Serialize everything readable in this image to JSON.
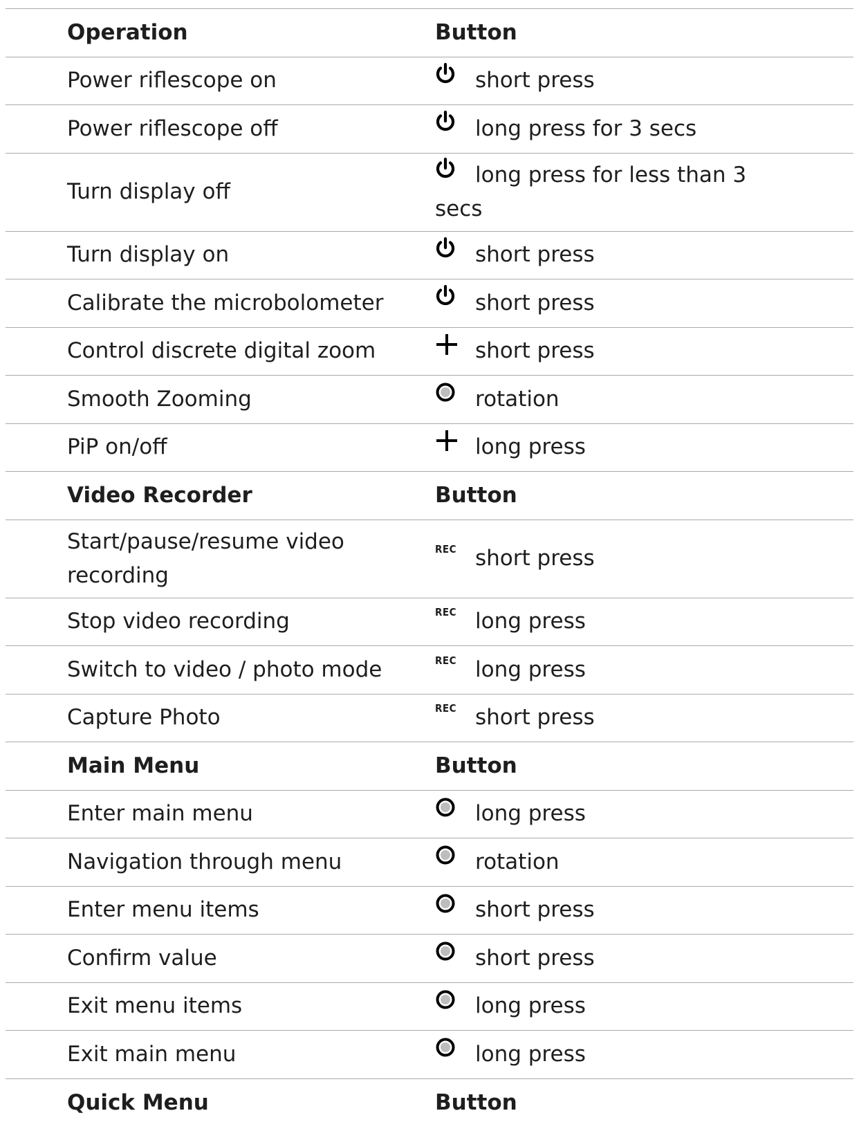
{
  "headers": {
    "operation": "Operation",
    "video_recorder": "Video Recorder",
    "main_menu": "Main Menu",
    "quick_menu": "Quick Menu",
    "button": "Button"
  },
  "icons": {
    "rec_label": "REC"
  },
  "rows": [
    {
      "operation": "Power riflescope on",
      "icon": "power-icon",
      "action": "short press"
    },
    {
      "operation": "Power riflescope off",
      "icon": "power-icon",
      "action": "long press for 3 secs"
    },
    {
      "operation": "Turn display off",
      "icon": "power-icon",
      "action": "long press for less than 3 secs"
    },
    {
      "operation": "Turn display on",
      "icon": "power-icon",
      "action": "short press"
    },
    {
      "operation": "Calibrate the microbolometer",
      "icon": "power-icon",
      "action": "short press"
    },
    {
      "operation": "Control discrete digital zoom",
      "icon": "plus-icon",
      "action": "short press"
    },
    {
      "operation": "Smooth Zooming",
      "icon": "controller-icon",
      "action": "rotation"
    },
    {
      "operation": "PiP on/off",
      "icon": "plus-icon",
      "action": "long press"
    },
    {
      "operation": "Start/pause/resume video recording",
      "icon": "rec-icon",
      "action": "short press"
    },
    {
      "operation": "Stop video recording",
      "icon": "rec-icon",
      "action": "long press"
    },
    {
      "operation": "Switch to video / photo mode",
      "icon": "rec-icon",
      "action": "long press"
    },
    {
      "operation": "Capture Photo",
      "icon": "rec-icon",
      "action": "short press"
    },
    {
      "operation": "Enter main menu",
      "icon": "controller-icon",
      "action": "long press"
    },
    {
      "operation": "Navigation through menu",
      "icon": "controller-icon",
      "action": "rotation"
    },
    {
      "operation": "Enter menu items",
      "icon": "controller-icon",
      "action": "short press"
    },
    {
      "operation": "Confirm value",
      "icon": "controller-icon",
      "action": "short press"
    },
    {
      "operation": "Exit menu items",
      "icon": "controller-icon",
      "action": "long press"
    },
    {
      "operation": "Exit main menu",
      "icon": "controller-icon",
      "action": "long press"
    }
  ]
}
